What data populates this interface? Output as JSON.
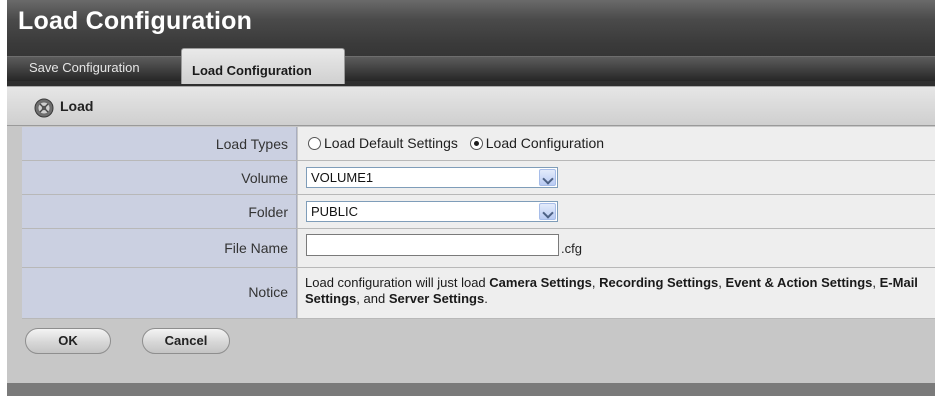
{
  "window": {
    "title": "Load Configuration"
  },
  "tabs": [
    {
      "label": "Save Configuration",
      "active": false
    },
    {
      "label": "Load Configuration",
      "active": true
    }
  ],
  "section": {
    "title": "Load",
    "icon": "load-icon"
  },
  "form": {
    "load_types": {
      "label": "Load Types",
      "options": [
        {
          "label": "Load Default Settings",
          "selected": false
        },
        {
          "label": "Load Configuration",
          "selected": true
        }
      ]
    },
    "volume": {
      "label": "Volume",
      "value": "VOLUME1"
    },
    "folder": {
      "label": "Folder",
      "value": "PUBLIC"
    },
    "file_name": {
      "label": "File Name",
      "value": "",
      "suffix": ".cfg"
    },
    "notice": {
      "label": "Notice",
      "prefix": "Load configuration will just load ",
      "items": [
        "Camera Settings",
        "Recording Settings",
        "Event & Action Settings",
        "E-Mail Settings",
        "Server Settings"
      ],
      "sep1": ", ",
      "sep2": ", ",
      "sep3": ", ",
      "sep4": ", and ",
      "end": "."
    }
  },
  "buttons": {
    "ok": "OK",
    "cancel": "Cancel"
  },
  "colors": {
    "title_bar": "#4a4a4a",
    "label_cell": "#cbd0e1",
    "value_cell": "#eeeeee",
    "panel": "#c7c7c7"
  }
}
